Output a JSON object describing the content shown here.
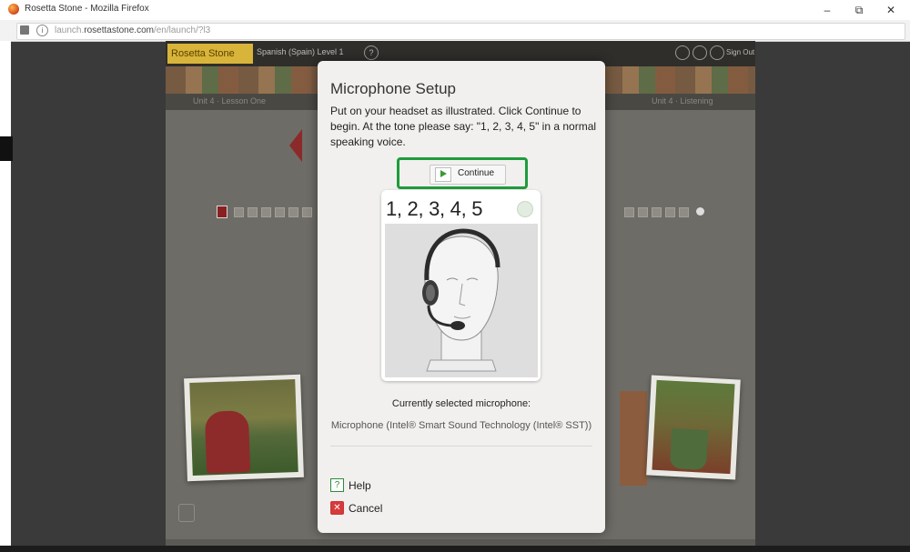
{
  "browser": {
    "window_title": "Rosetta Stone - Mozilla Firefox",
    "url_prefix": "launch.",
    "url_domain": "rosettastone.com",
    "url_path": "/en/launch/?l3",
    "window_controls": {
      "minimize": "–",
      "restore": "⧉",
      "close": "✕"
    }
  },
  "app": {
    "logo": "Rosetta Stone",
    "course_title": "Spanish (Spain) Level 1",
    "help_glyph": "?",
    "signout": "Sign Out",
    "lesson_left": "Unit 4 · Lesson One",
    "lesson_right": "Unit 4 · Listening"
  },
  "dialog": {
    "title": "Microphone Setup",
    "instruction": "Put on your headset as illustrated. Click Continue to begin. At the tone please say: \"1, 2, 3, 4, 5\" in a normal speaking voice.",
    "continue_label": "Continue",
    "count_text": "1, 2, 3, 4, 5",
    "mic_label": "Currently selected microphone:",
    "mic_name": "Microphone (Intel® Smart Sound Technology (Intel® SST))",
    "help_label": "Help",
    "cancel_label": "Cancel"
  },
  "colors": {
    "highlight": "#1e9b3c",
    "cancel_icon": "#d63a3a",
    "play_icon": "#3a9a3a"
  }
}
